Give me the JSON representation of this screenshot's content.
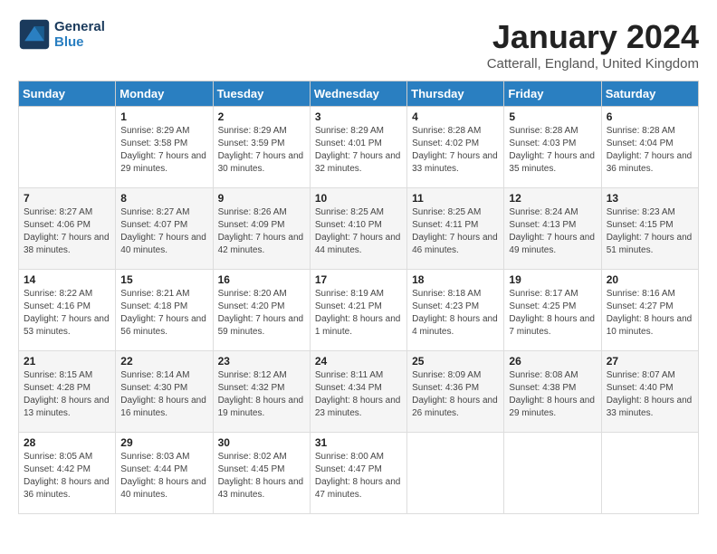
{
  "logo": {
    "line1": "General",
    "line2": "Blue"
  },
  "title": "January 2024",
  "subtitle": "Catterall, England, United Kingdom",
  "weekdays": [
    "Sunday",
    "Monday",
    "Tuesday",
    "Wednesday",
    "Thursday",
    "Friday",
    "Saturday"
  ],
  "weeks": [
    [
      {
        "day": "",
        "sunrise": "",
        "sunset": "",
        "daylight": ""
      },
      {
        "day": "1",
        "sunrise": "Sunrise: 8:29 AM",
        "sunset": "Sunset: 3:58 PM",
        "daylight": "Daylight: 7 hours and 29 minutes."
      },
      {
        "day": "2",
        "sunrise": "Sunrise: 8:29 AM",
        "sunset": "Sunset: 3:59 PM",
        "daylight": "Daylight: 7 hours and 30 minutes."
      },
      {
        "day": "3",
        "sunrise": "Sunrise: 8:29 AM",
        "sunset": "Sunset: 4:01 PM",
        "daylight": "Daylight: 7 hours and 32 minutes."
      },
      {
        "day": "4",
        "sunrise": "Sunrise: 8:28 AM",
        "sunset": "Sunset: 4:02 PM",
        "daylight": "Daylight: 7 hours and 33 minutes."
      },
      {
        "day": "5",
        "sunrise": "Sunrise: 8:28 AM",
        "sunset": "Sunset: 4:03 PM",
        "daylight": "Daylight: 7 hours and 35 minutes."
      },
      {
        "day": "6",
        "sunrise": "Sunrise: 8:28 AM",
        "sunset": "Sunset: 4:04 PM",
        "daylight": "Daylight: 7 hours and 36 minutes."
      }
    ],
    [
      {
        "day": "7",
        "sunrise": "Sunrise: 8:27 AM",
        "sunset": "Sunset: 4:06 PM",
        "daylight": "Daylight: 7 hours and 38 minutes."
      },
      {
        "day": "8",
        "sunrise": "Sunrise: 8:27 AM",
        "sunset": "Sunset: 4:07 PM",
        "daylight": "Daylight: 7 hours and 40 minutes."
      },
      {
        "day": "9",
        "sunrise": "Sunrise: 8:26 AM",
        "sunset": "Sunset: 4:09 PM",
        "daylight": "Daylight: 7 hours and 42 minutes."
      },
      {
        "day": "10",
        "sunrise": "Sunrise: 8:25 AM",
        "sunset": "Sunset: 4:10 PM",
        "daylight": "Daylight: 7 hours and 44 minutes."
      },
      {
        "day": "11",
        "sunrise": "Sunrise: 8:25 AM",
        "sunset": "Sunset: 4:11 PM",
        "daylight": "Daylight: 7 hours and 46 minutes."
      },
      {
        "day": "12",
        "sunrise": "Sunrise: 8:24 AM",
        "sunset": "Sunset: 4:13 PM",
        "daylight": "Daylight: 7 hours and 49 minutes."
      },
      {
        "day": "13",
        "sunrise": "Sunrise: 8:23 AM",
        "sunset": "Sunset: 4:15 PM",
        "daylight": "Daylight: 7 hours and 51 minutes."
      }
    ],
    [
      {
        "day": "14",
        "sunrise": "Sunrise: 8:22 AM",
        "sunset": "Sunset: 4:16 PM",
        "daylight": "Daylight: 7 hours and 53 minutes."
      },
      {
        "day": "15",
        "sunrise": "Sunrise: 8:21 AM",
        "sunset": "Sunset: 4:18 PM",
        "daylight": "Daylight: 7 hours and 56 minutes."
      },
      {
        "day": "16",
        "sunrise": "Sunrise: 8:20 AM",
        "sunset": "Sunset: 4:20 PM",
        "daylight": "Daylight: 7 hours and 59 minutes."
      },
      {
        "day": "17",
        "sunrise": "Sunrise: 8:19 AM",
        "sunset": "Sunset: 4:21 PM",
        "daylight": "Daylight: 8 hours and 1 minute."
      },
      {
        "day": "18",
        "sunrise": "Sunrise: 8:18 AM",
        "sunset": "Sunset: 4:23 PM",
        "daylight": "Daylight: 8 hours and 4 minutes."
      },
      {
        "day": "19",
        "sunrise": "Sunrise: 8:17 AM",
        "sunset": "Sunset: 4:25 PM",
        "daylight": "Daylight: 8 hours and 7 minutes."
      },
      {
        "day": "20",
        "sunrise": "Sunrise: 8:16 AM",
        "sunset": "Sunset: 4:27 PM",
        "daylight": "Daylight: 8 hours and 10 minutes."
      }
    ],
    [
      {
        "day": "21",
        "sunrise": "Sunrise: 8:15 AM",
        "sunset": "Sunset: 4:28 PM",
        "daylight": "Daylight: 8 hours and 13 minutes."
      },
      {
        "day": "22",
        "sunrise": "Sunrise: 8:14 AM",
        "sunset": "Sunset: 4:30 PM",
        "daylight": "Daylight: 8 hours and 16 minutes."
      },
      {
        "day": "23",
        "sunrise": "Sunrise: 8:12 AM",
        "sunset": "Sunset: 4:32 PM",
        "daylight": "Daylight: 8 hours and 19 minutes."
      },
      {
        "day": "24",
        "sunrise": "Sunrise: 8:11 AM",
        "sunset": "Sunset: 4:34 PM",
        "daylight": "Daylight: 8 hours and 23 minutes."
      },
      {
        "day": "25",
        "sunrise": "Sunrise: 8:09 AM",
        "sunset": "Sunset: 4:36 PM",
        "daylight": "Daylight: 8 hours and 26 minutes."
      },
      {
        "day": "26",
        "sunrise": "Sunrise: 8:08 AM",
        "sunset": "Sunset: 4:38 PM",
        "daylight": "Daylight: 8 hours and 29 minutes."
      },
      {
        "day": "27",
        "sunrise": "Sunrise: 8:07 AM",
        "sunset": "Sunset: 4:40 PM",
        "daylight": "Daylight: 8 hours and 33 minutes."
      }
    ],
    [
      {
        "day": "28",
        "sunrise": "Sunrise: 8:05 AM",
        "sunset": "Sunset: 4:42 PM",
        "daylight": "Daylight: 8 hours and 36 minutes."
      },
      {
        "day": "29",
        "sunrise": "Sunrise: 8:03 AM",
        "sunset": "Sunset: 4:44 PM",
        "daylight": "Daylight: 8 hours and 40 minutes."
      },
      {
        "day": "30",
        "sunrise": "Sunrise: 8:02 AM",
        "sunset": "Sunset: 4:45 PM",
        "daylight": "Daylight: 8 hours and 43 minutes."
      },
      {
        "day": "31",
        "sunrise": "Sunrise: 8:00 AM",
        "sunset": "Sunset: 4:47 PM",
        "daylight": "Daylight: 8 hours and 47 minutes."
      },
      {
        "day": "",
        "sunrise": "",
        "sunset": "",
        "daylight": ""
      },
      {
        "day": "",
        "sunrise": "",
        "sunset": "",
        "daylight": ""
      },
      {
        "day": "",
        "sunrise": "",
        "sunset": "",
        "daylight": ""
      }
    ]
  ]
}
